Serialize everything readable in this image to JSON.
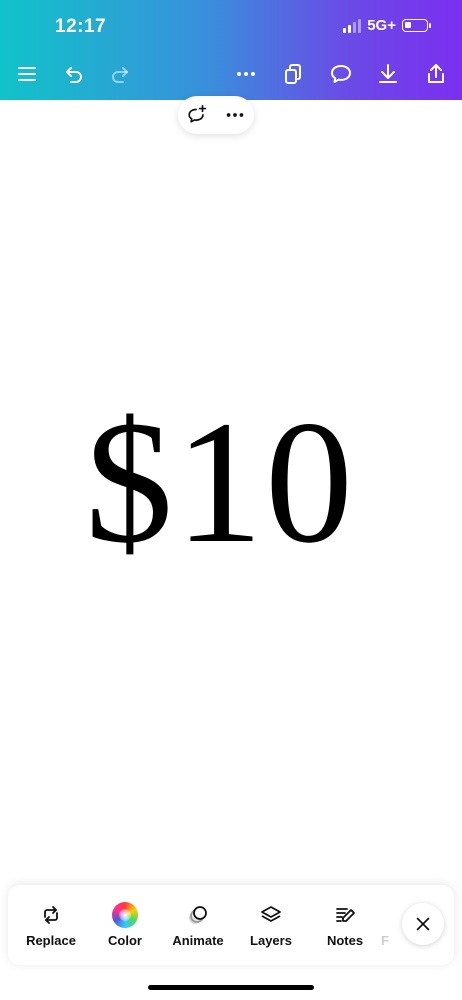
{
  "status_bar": {
    "time": "12:17",
    "network": "5G+",
    "signal_bars": 4,
    "signal_active_bars": 2,
    "battery_level": 0.2
  },
  "toolbar": {
    "icons": [
      "menu-icon",
      "undo-icon",
      "redo-icon",
      "more-icon",
      "duplicate-icon",
      "comment-icon",
      "download-icon",
      "share-icon"
    ]
  },
  "floating_menu": {
    "icons": [
      "add-comment-icon",
      "more-icon"
    ]
  },
  "canvas": {
    "text": "$10"
  },
  "bottom_tools": {
    "items": [
      {
        "label": "Replace",
        "icon": "replace-icon"
      },
      {
        "label": "Color",
        "icon": "color-wheel-icon"
      },
      {
        "label": "Animate",
        "icon": "animate-icon"
      },
      {
        "label": "Layers",
        "icon": "layers-icon"
      },
      {
        "label": "Notes",
        "icon": "notes-icon"
      },
      {
        "label": "F",
        "icon": ""
      }
    ],
    "close_icon": "close-icon"
  },
  "colors": {
    "gradient_start": "#10c3c9",
    "gradient_end": "#7b2ff0",
    "text": "#000000"
  }
}
